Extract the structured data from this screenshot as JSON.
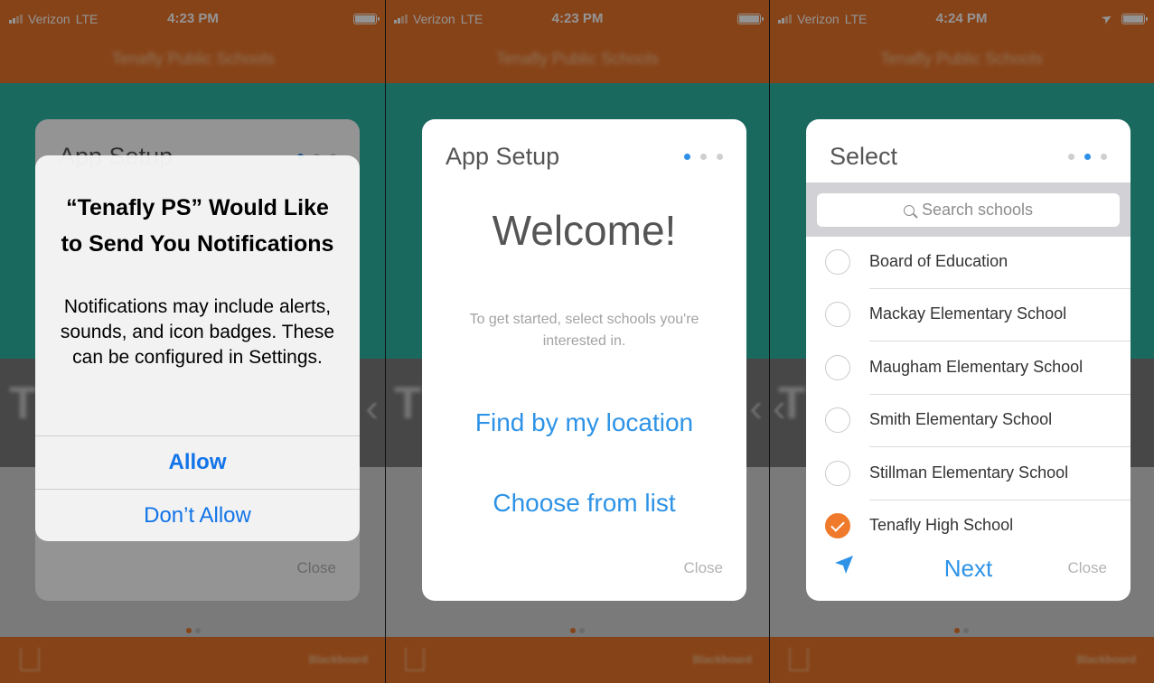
{
  "status": {
    "carrier": "Verizon",
    "network": "LTE",
    "time_1": "4:23 PM",
    "time_2": "4:23 PM",
    "time_3": "4:24 PM"
  },
  "app": {
    "header_title": "Tenafly Public Schools",
    "footer_brand": "Blackboard",
    "background_initial": "T"
  },
  "alert": {
    "title": "“Tenafly PS” Would Like to Send You Notifications",
    "message": "Notifications may include alerts, sounds, and icon badges. These can be configured in Settings.",
    "allow": "Allow",
    "deny": "Don’t Allow"
  },
  "setup": {
    "title": "App Setup",
    "welcome": "Welcome!",
    "intro": "To get started, select schools you're interested in.",
    "find_location": "Find by my location",
    "choose_list": "Choose from list",
    "close": "Close"
  },
  "select": {
    "title": "Select",
    "search_placeholder": "Search schools",
    "schools": [
      {
        "name": "Board of Education",
        "checked": false
      },
      {
        "name": "Mackay Elementary School",
        "checked": false
      },
      {
        "name": "Maugham Elementary School",
        "checked": false
      },
      {
        "name": "Smith Elementary School",
        "checked": false
      },
      {
        "name": "Stillman Elementary School",
        "checked": false
      },
      {
        "name": "Tenafly High School",
        "checked": true
      }
    ],
    "next": "Next",
    "close": "Close"
  },
  "colors": {
    "brand_orange": "#e8742a",
    "teal": "#2bb6a2",
    "link_blue": "#2e93e6",
    "ios_blue": "#1274e8"
  },
  "icons": [
    "signal-bars-icon",
    "battery-icon",
    "location-arrow-icon",
    "search-icon",
    "share-icon",
    "check-icon"
  ]
}
